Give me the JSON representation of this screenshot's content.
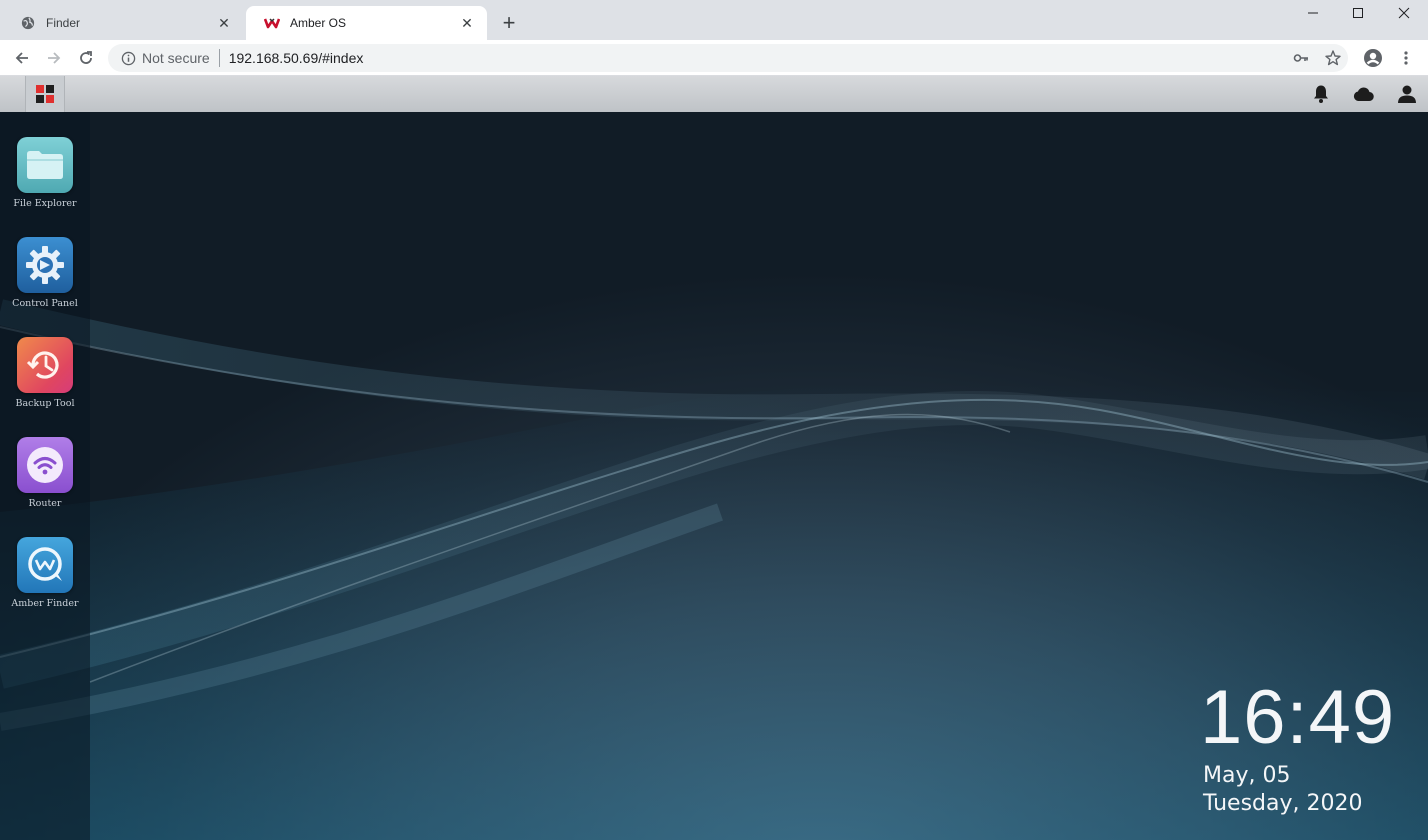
{
  "browser": {
    "tabs": [
      {
        "title": "Finder",
        "icon": "globe-icon",
        "active": false
      },
      {
        "title": "Amber OS",
        "icon": "amber-logo-icon",
        "active": true
      }
    ],
    "security_label": "Not secure",
    "url": "192.168.50.69/#index"
  },
  "app": {
    "desktop_icons": [
      {
        "label": "File Explorer",
        "icon": "folder-icon",
        "color": "#5fbcc4"
      },
      {
        "label": "Control Panel",
        "icon": "gear-icon",
        "color": "#2e77b8"
      },
      {
        "label": "Backup Tool",
        "icon": "clock-restore-icon",
        "color": "#e8585a"
      },
      {
        "label": "Router",
        "icon": "wifi-icon",
        "color": "#9b5fd6"
      },
      {
        "label": "Amber Finder",
        "icon": "chat-search-icon",
        "color": "#2e8fcf"
      }
    ]
  },
  "clock": {
    "time": "16:49",
    "date": "May, 05",
    "day": "Tuesday, 2020"
  }
}
